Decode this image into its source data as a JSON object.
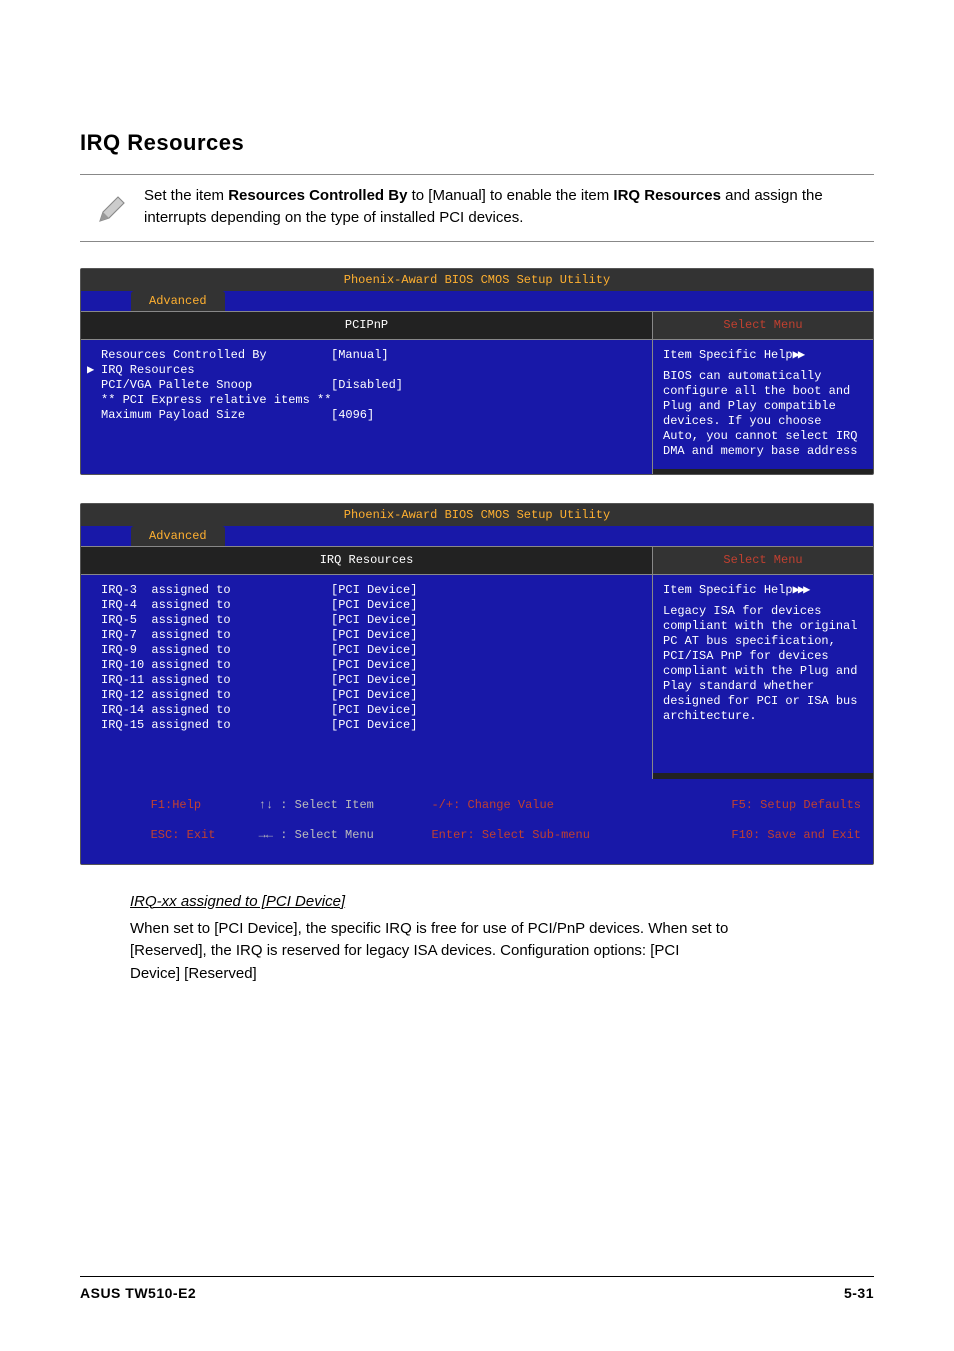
{
  "heading": "IRQ Resources",
  "note": {
    "pre": "Set the item ",
    "bold1": "Resources Controlled By",
    "mid1": " to [Manual] to enable the item ",
    "bold2": "IRQ Resources",
    "post": " and assign the interrupts depending on the type of installed PCI devices."
  },
  "bios1": {
    "header": "Phoenix-Award BIOS CMOS Setup Utility",
    "tab": "Advanced",
    "main_title": "PCIPnP",
    "side_title": "Select Menu",
    "items": [
      {
        "label": "Resources Controlled By",
        "value": "[Manual]",
        "pointer": false
      },
      {
        "label": "IRQ Resources",
        "value": "",
        "pointer": true
      },
      {
        "label": "",
        "value": "",
        "pointer": false
      },
      {
        "label": "PCI/VGA Pallete Snoop",
        "value": "[Disabled]",
        "pointer": false
      },
      {
        "label": "",
        "value": "",
        "pointer": false
      },
      {
        "label": "** PCI Express relative items **",
        "value": "",
        "pointer": false
      },
      {
        "label": "Maximum Payload Size",
        "value": "[4096]",
        "pointer": false
      }
    ],
    "help_title": "Item Specific Help",
    "help_body": "BIOS can automatically configure all the boot and Plug and Play compatible devices. If you choose Auto, you cannot select IRQ DMA and memory base address"
  },
  "bios2": {
    "header": "Phoenix-Award BIOS CMOS Setup Utility",
    "tab": "Advanced",
    "main_title": "IRQ Resources",
    "side_title": "Select Menu",
    "items": [
      {
        "label": "IRQ-3  assigned to",
        "value": "[PCI Device]"
      },
      {
        "label": "IRQ-4  assigned to",
        "value": "[PCI Device]"
      },
      {
        "label": "IRQ-5  assigned to",
        "value": "[PCI Device]"
      },
      {
        "label": "IRQ-7  assigned to",
        "value": "[PCI Device]"
      },
      {
        "label": "IRQ-9  assigned to",
        "value": "[PCI Device]"
      },
      {
        "label": "IRQ-10 assigned to",
        "value": "[PCI Device]"
      },
      {
        "label": "IRQ-11 assigned to",
        "value": "[PCI Device]"
      },
      {
        "label": "IRQ-12 assigned to",
        "value": "[PCI Device]"
      },
      {
        "label": "IRQ-14 assigned to",
        "value": "[PCI Device]"
      },
      {
        "label": "IRQ-15 assigned to",
        "value": "[PCI Device]"
      }
    ],
    "help_title": "Item Specific Help",
    "help_body": "Legacy ISA for devices compliant with the original PC AT bus specification, PCI/ISA PnP for devices compliant with the Plug and Play standard whether designed for PCI or ISA bus architecture.",
    "footer": {
      "f1": "F1:Help",
      "sel_item": ": Select Item",
      "change": "-/+: Change Value",
      "f5": "F5: Setup Defaults",
      "esc": "ESC: Exit",
      "sel_menu": ": Select Menu",
      "enter": "Enter: Select Sub-menu",
      "f10": "F10: Save and Exit"
    }
  },
  "sub_heading": "IRQ-xx assigned to [PCI Device]",
  "body_para": "When set to [PCI Device], the specific IRQ is free for use of PCI/PnP devices. When set to [Reserved], the IRQ is reserved for legacy ISA devices. Configuration options: [PCI Device] [Reserved]",
  "footer_left": "ASUS TW510-E2",
  "footer_right": "5-31"
}
